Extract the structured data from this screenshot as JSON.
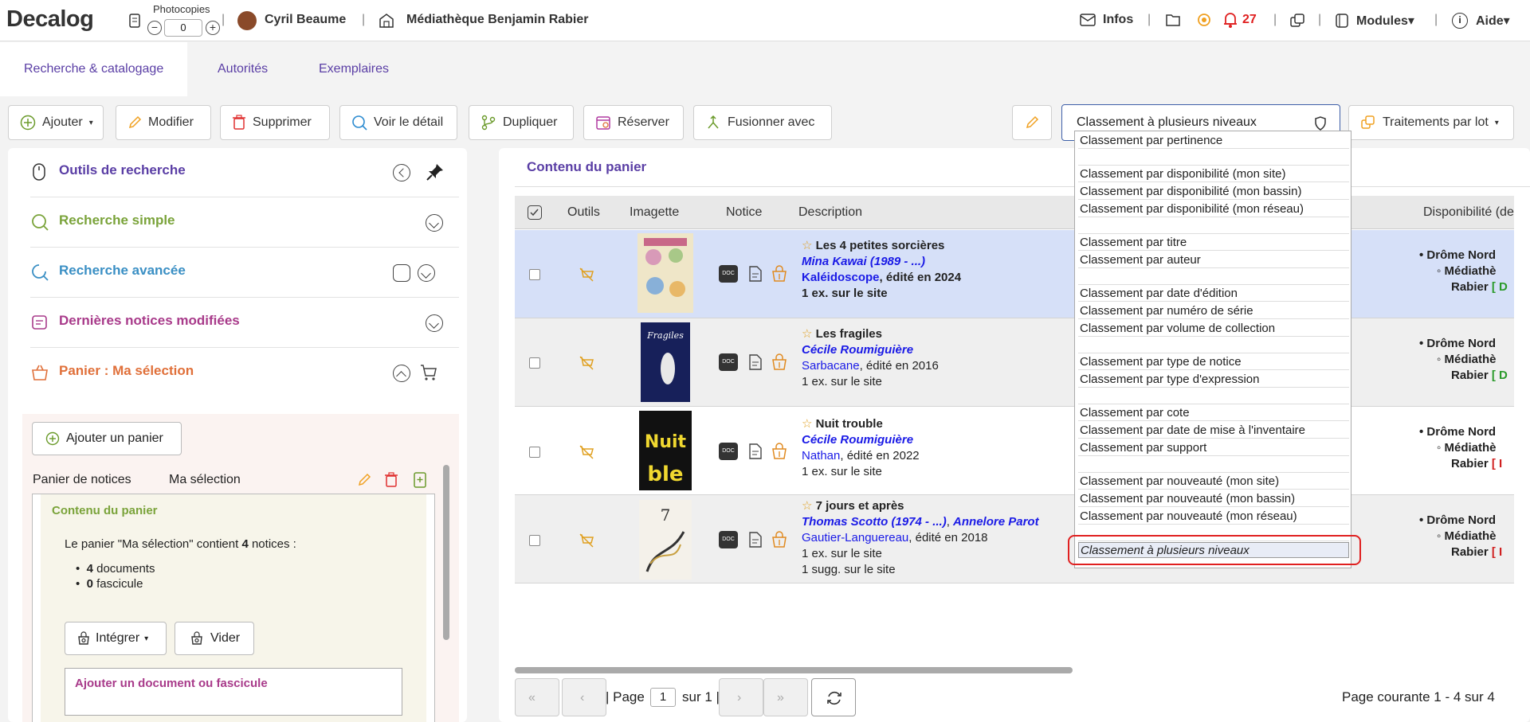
{
  "app": {
    "logo": "Decalog"
  },
  "topbar": {
    "photocopies_label": "Photocopies",
    "photocopies_minus": "−",
    "photocopies_plus": "+",
    "photocopies_value": "0",
    "user_name": "Cyril Beaume",
    "library_name": "Médiathèque Benjamin Rabier",
    "infos_label": "Infos",
    "notif_count": "27",
    "modules_label": "Modules",
    "help_label": "Aide"
  },
  "tabs": [
    {
      "label": "Recherche & catalogage"
    },
    {
      "label": "Autorités"
    },
    {
      "label": "Exemplaires"
    }
  ],
  "toolbar": {
    "add": "Ajouter",
    "edit": "Modifier",
    "delete": "Supprimer",
    "detail": "Voir le détail",
    "duplicate": "Dupliquer",
    "reserve": "Réserver",
    "merge": "Fusionner avec",
    "sort_selected": "Classement à plusieurs niveaux",
    "batch": "Traitements par lot"
  },
  "sidebar": {
    "items": [
      {
        "label": "Outils de recherche",
        "color": "#5a3ea5"
      },
      {
        "label": "Recherche simple",
        "color": "#7aa33a"
      },
      {
        "label": "Recherche avancée",
        "color": "#3a8fc4"
      },
      {
        "label": "Dernières notices modifiées",
        "color": "#a83a8a"
      },
      {
        "label": "Panier : Ma sélection",
        "color": "#e0703a"
      }
    ],
    "add_basket": "Ajouter un panier",
    "basket_type": "Panier de notices",
    "basket_name": "Ma sélection",
    "content_title": "Contenu du panier",
    "content_text_pre": "Le panier \"Ma sélection\" contient ",
    "content_count": "4",
    "content_text_post": " notices :",
    "docs_count": "4",
    "docs_label": " documents",
    "fasc_count": "0",
    "fasc_label": " fascicule",
    "integrate": "Intégrer",
    "empty": "Vider",
    "add_doc": "Ajouter un document ou fascicule"
  },
  "main": {
    "title": "Contenu du panier",
    "columns": {
      "tools": "Outils",
      "thumb": "Imagette",
      "notice": "Notice",
      "desc": "Description",
      "dispo": "Disponibilité (de"
    },
    "rows": [
      {
        "title": "Les 4 petites sorcières",
        "author": "Mina Kawai (1989 - ...)",
        "publisher": "Kaléidoscope",
        "edition": ", édité en 2024",
        "copies": "1 ex. sur le site",
        "sugg": "",
        "d1": "Drôme Nord",
        "d2": "Médiathè",
        "d3": "Rabier",
        "d4": "[ D"
      },
      {
        "title": "Les fragiles",
        "author": "Cécile Roumiguière",
        "publisher": "Sarbacane",
        "edition": ", édité en 2016",
        "copies": "1 ex. sur le site",
        "sugg": "",
        "d1": "Drôme Nord",
        "d2": "Médiathè",
        "d3": "Rabier",
        "d4": "[ D"
      },
      {
        "title": "Nuit trouble",
        "author": "Cécile Roumiguière",
        "publisher": "Nathan",
        "edition": ", édité en 2022",
        "copies": "1 ex. sur le site",
        "sugg": "",
        "d1": "Drôme Nord",
        "d2": "Médiathè",
        "d3": "Rabier",
        "d4": "[ I"
      },
      {
        "title": "7 jours et après",
        "author": "Thomas Scotto (1974 - ...)",
        "author2": "Annelore Parot",
        "publisher": "Gautier-Languereau",
        "edition": ", édité en 2018",
        "copies": "1 ex. sur le site",
        "sugg": "1 sugg. sur le site",
        "d1": "Drôme Nord",
        "d2": "Médiathè",
        "d3": "Rabier",
        "d4": "[ I"
      }
    ],
    "pager": {
      "page_label": "Page",
      "page_value": "1",
      "of_label": "sur 1",
      "status": "Page courante 1 - 4 sur 4"
    }
  },
  "dropdown": {
    "options": [
      "Classement par pertinence",
      "",
      "Classement par disponibilité (mon site)",
      "Classement par disponibilité (mon bassin)",
      "Classement par disponibilité (mon réseau)",
      "",
      "Classement par titre",
      "Classement par auteur",
      "",
      "Classement par date d'édition",
      "Classement par numéro de série",
      "Classement par volume de collection",
      "",
      "Classement par type de notice",
      "Classement par type d'expression",
      "",
      "Classement par cote",
      "Classement par date de mise à l'inventaire",
      "Classement par support",
      "",
      "Classement par nouveauté (mon site)",
      "Classement par nouveauté (mon bassin)",
      "Classement par nouveauté (mon réseau)",
      "",
      "Classement à plusieurs niveaux"
    ]
  }
}
